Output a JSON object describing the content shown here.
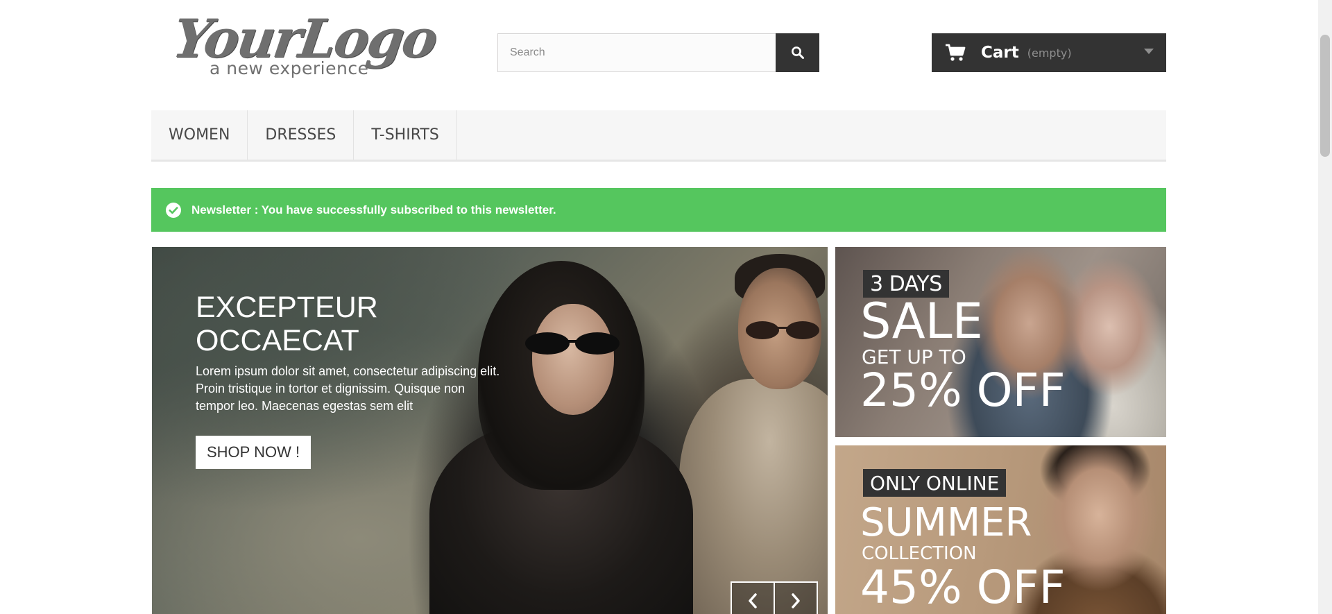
{
  "header": {
    "logo": {
      "script_text": "YourLogo",
      "tagline": "a new experience"
    },
    "search": {
      "placeholder": "Search",
      "button_icon": "search-icon"
    },
    "cart": {
      "label": "Cart",
      "status": "(empty)",
      "icon": "shopping-cart-icon",
      "dropdown_icon": "caret-down-icon"
    }
  },
  "nav": {
    "items": [
      {
        "label": "WOMEN"
      },
      {
        "label": "DRESSES"
      },
      {
        "label": "T-SHIRTS"
      }
    ]
  },
  "alert": {
    "icon": "check-circle-icon",
    "text": "Newsletter : You have successfully subscribed to this newsletter.",
    "color": "#55c65e"
  },
  "hero": {
    "title": "EXCEPTEUR OCCAECAT",
    "text": "Lorem ipsum dolor sit amet, consectetur adipiscing elit. Proin tristique in tortor et dignissim. Quisque non tempor leo. Maecenas egestas sem elit",
    "button_label": "SHOP NOW !",
    "prev_icon": "chevron-left-icon",
    "next_icon": "chevron-right-icon"
  },
  "banners": [
    {
      "badge": "3 DAYS",
      "headline": "SALE",
      "subline": "GET UP TO",
      "discount": "25% OFF"
    },
    {
      "badge": "ONLY ONLINE",
      "headline": "SUMMER",
      "subline": "COLLECTION",
      "discount": "45% OFF"
    }
  ],
  "colors": {
    "dark": "#333333",
    "nav_bg": "#f6f6f6",
    "success": "#55c65e"
  }
}
